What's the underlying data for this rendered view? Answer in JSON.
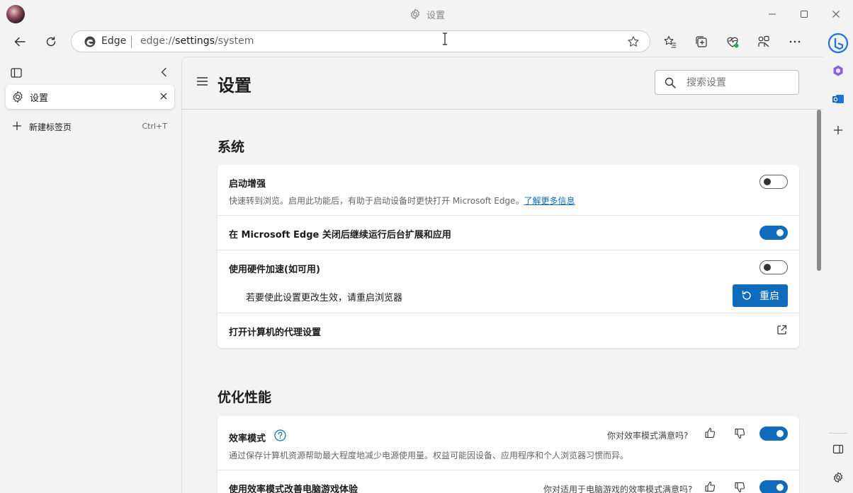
{
  "window": {
    "title": "设置"
  },
  "address_bar": {
    "site_label": "Edge",
    "url_prefix": "edge://",
    "url_host": "settings",
    "url_path": "/system"
  },
  "tabs_pane": {
    "active_tab": {
      "label": "设置"
    },
    "new_tab": {
      "label": "新建标签页",
      "shortcut": "Ctrl+T"
    }
  },
  "header": {
    "title": "设置",
    "search_placeholder": "搜索设置"
  },
  "sections": {
    "system": {
      "title": "系统",
      "startup_boost": {
        "title": "启动增强",
        "desc": "快速转到浏览。启用此功能后，有助于启动设备时更快打开 Microsoft Edge。",
        "link": "了解更多信息",
        "enabled": false
      },
      "background_run": {
        "title": "在 Microsoft Edge 关闭后继续运行后台扩展和应用",
        "enabled": true
      },
      "hardware_accel": {
        "title": "使用硬件加速(如可用)",
        "enabled": false,
        "restart_note": "若要使此设置更改生效，请重启浏览器",
        "restart_label": "重启"
      },
      "proxy": {
        "title": "打开计算机的代理设置"
      }
    },
    "performance": {
      "title": "优化性能",
      "efficiency_mode": {
        "title": "效率模式",
        "feedback_question": "你对效率模式满意吗?",
        "desc": "通过保存计算机资源帮助最大程度地减少电源使用量。权益可能因设备、应用程序和个人浏览器习惯而异。",
        "enabled": true
      },
      "gaming": {
        "title": "使用效率模式改善电脑游戏体验",
        "feedback_question": "你对适用于电脑游戏的效率模式满意吗?",
        "enabled": true
      }
    }
  },
  "colors": {
    "accent": "#0f6cbd",
    "background": "#f3f3f3",
    "card": "#ffffff"
  }
}
